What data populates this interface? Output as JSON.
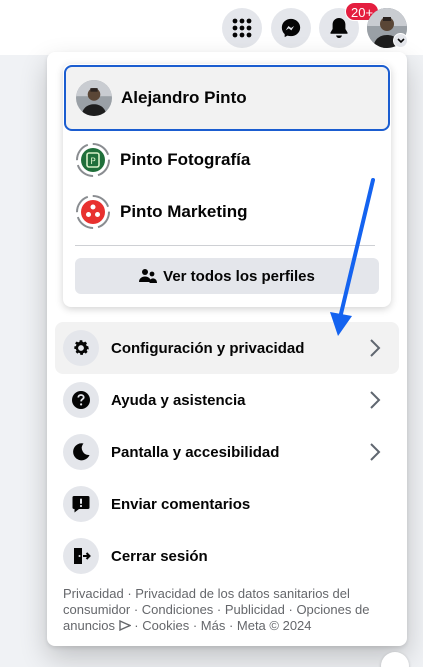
{
  "topbar": {
    "notifications_badge": "20+",
    "icons": [
      "apps-grid-icon",
      "messenger-icon",
      "bell-icon"
    ]
  },
  "profiles": {
    "selected": {
      "name": "Alejandro Pinto"
    },
    "items": [
      {
        "name": "Pinto Fotografía",
        "color": "#1f6f3a"
      },
      {
        "name": "Pinto Marketing",
        "color": "#e8312f"
      }
    ],
    "see_all_label": "Ver todos los perfiles"
  },
  "menu": {
    "items": [
      {
        "label": "Configuración y privacidad",
        "icon": "gear-icon"
      },
      {
        "label": "Ayuda y asistencia",
        "icon": "help-icon"
      },
      {
        "label": "Pantalla y accesibilidad",
        "icon": "moon-icon"
      },
      {
        "label": "Enviar comentarios",
        "icon": "feedback-icon"
      },
      {
        "label": "Cerrar sesión",
        "icon": "logout-icon"
      }
    ]
  },
  "footer": {
    "privacy": "Privacidad",
    "health_privacy": "Privacidad de los datos sanitarios del consumidor",
    "terms": "Condiciones",
    "ads": "Publicidad",
    "ad_choices": "Opciones de anuncios",
    "cookies": "Cookies",
    "more": "Más",
    "copyright": "Meta © 2024",
    "separator": " · "
  },
  "colors": {
    "accent_blue": "#1b5dd0",
    "badge_red": "#e41e3f",
    "annotation_arrow": "#1463f0"
  }
}
